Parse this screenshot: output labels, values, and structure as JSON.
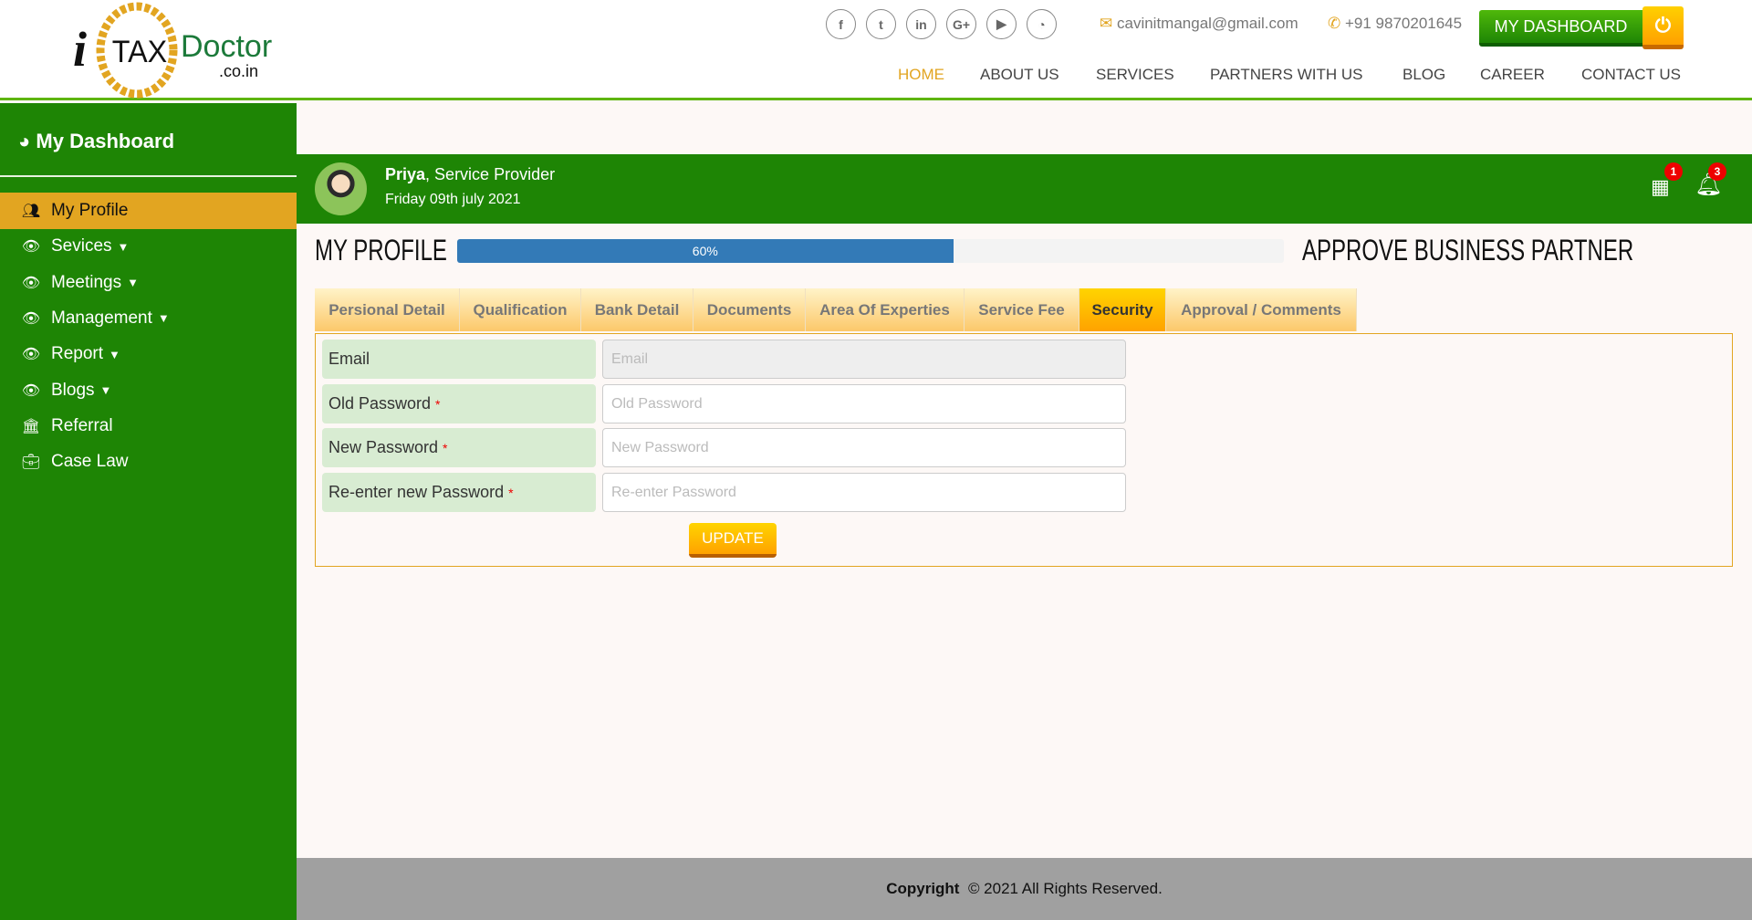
{
  "logo": {
    "text": "iTAX Doctor .co.in"
  },
  "header": {
    "social": [
      {
        "icon": "facebook-icon",
        "glyph": "f"
      },
      {
        "icon": "twitter-icon",
        "glyph": "t"
      },
      {
        "icon": "linkedin-icon",
        "glyph": "in"
      },
      {
        "icon": "google-plus-icon",
        "glyph": "G+"
      },
      {
        "icon": "youtube-icon",
        "glyph": "▶"
      },
      {
        "icon": "rss-icon",
        "glyph": "◔"
      }
    ],
    "email": "cavinitmangal@gmail.com",
    "phone": "+91 9870201645",
    "dashboard_label": "MY DASHBOARD",
    "nav": [
      "HOME",
      "ABOUT US",
      "SERVICES",
      "PARTNERS WITH US",
      "BLOG",
      "CAREER",
      "CONTACT US"
    ]
  },
  "sidebar": {
    "title": "My Dashboard",
    "items": [
      {
        "label": "My Profile",
        "icon": "users-icon"
      },
      {
        "label": "Sevices",
        "icon": "eye-icon",
        "caret": true
      },
      {
        "label": "Meetings",
        "icon": "eye-icon",
        "caret": true
      },
      {
        "label": "Management",
        "icon": "eye-icon",
        "caret": true
      },
      {
        "label": "Report",
        "icon": "eye-icon",
        "caret": true
      },
      {
        "label": "Blogs",
        "icon": "eye-icon",
        "caret": true
      },
      {
        "label": "Referral",
        "icon": "bank-icon"
      },
      {
        "label": "Case Law",
        "icon": "briefcase-icon"
      }
    ]
  },
  "user": {
    "name": "Priya",
    "role": ", Service Provider",
    "date": "Friday 09th july 2021",
    "calendar_count": "1",
    "notification_count": "3"
  },
  "profile": {
    "title": "MY PROFILE",
    "progress_label": "60%",
    "progress": 60,
    "approve_title": "APPROVE BUSINESS PARTNER"
  },
  "tabs": [
    "Persional Detail",
    "Qualification",
    "Bank Detail",
    "Documents",
    "Area Of Experties",
    "Service Fee",
    "Security",
    "Approval / Comments"
  ],
  "active_tab": "Security",
  "form": {
    "fields": [
      {
        "label": "Email",
        "placeholder": "Email",
        "required": false,
        "disabled": true
      },
      {
        "label": "Old Password",
        "placeholder": "Old Password",
        "required": true
      },
      {
        "label": "New Password",
        "placeholder": "New Password",
        "required": true
      },
      {
        "label": "Re-enter new Password",
        "placeholder": "Re-enter Password",
        "required": true
      }
    ],
    "required_mark": "*",
    "update_label": "UPDATE"
  },
  "footer": {
    "bold": "Copyright",
    "text": "© 2021 All Rights Reserved."
  },
  "colors": {
    "green": "#1e8505",
    "accent": "#e2a521",
    "progress": "#337ab7"
  }
}
